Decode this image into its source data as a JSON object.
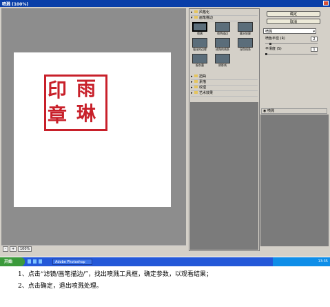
{
  "window": {
    "title": "喷溅 (100%)"
  },
  "preview": {
    "seal_chars": [
      "印",
      "雨",
      "章",
      "琳"
    ],
    "statusbar": {
      "zoom_minus": "-",
      "zoom_plus": "+",
      "zoom_value": "100%"
    }
  },
  "gallery": {
    "categories": [
      {
        "label": "风格化",
        "expanded": false
      },
      {
        "label": "画笔描边",
        "expanded": true
      },
      {
        "label": "扭曲",
        "expanded": false
      },
      {
        "label": "素描",
        "expanded": false
      },
      {
        "label": "纹理",
        "expanded": false
      },
      {
        "label": "艺术效果",
        "expanded": false
      }
    ],
    "thumbnails": [
      {
        "label": "喷溅",
        "selected": true
      },
      {
        "label": "喷色描边",
        "selected": false
      },
      {
        "label": "墨水轮廓",
        "selected": false
      },
      {
        "label": "强化的边缘",
        "selected": false
      },
      {
        "label": "成角的线条",
        "selected": false
      },
      {
        "label": "深色线条",
        "selected": false
      },
      {
        "label": "烟灰墨",
        "selected": false
      },
      {
        "label": "阴影线",
        "selected": false
      }
    ]
  },
  "settings": {
    "ok_label": "确定",
    "cancel_label": "取消",
    "filter_selected": "喷溅",
    "params": [
      {
        "label": "喷色半径 (R)",
        "value": "2",
        "fraction": 0.08
      },
      {
        "label": "平滑度 (S)",
        "value": "1",
        "fraction": 0.0
      }
    ],
    "layer_name": "喷溅"
  },
  "taskbar": {
    "start_label": "开始",
    "task_label": "Adobe Photoshop",
    "clock": "13:35"
  },
  "instructions": [
    "1、点击“滤镜/画笔描边/”，找出喷溅工具框，确定参数，以观看结果；",
    "2、点击确定，退出喷溅处理。"
  ]
}
